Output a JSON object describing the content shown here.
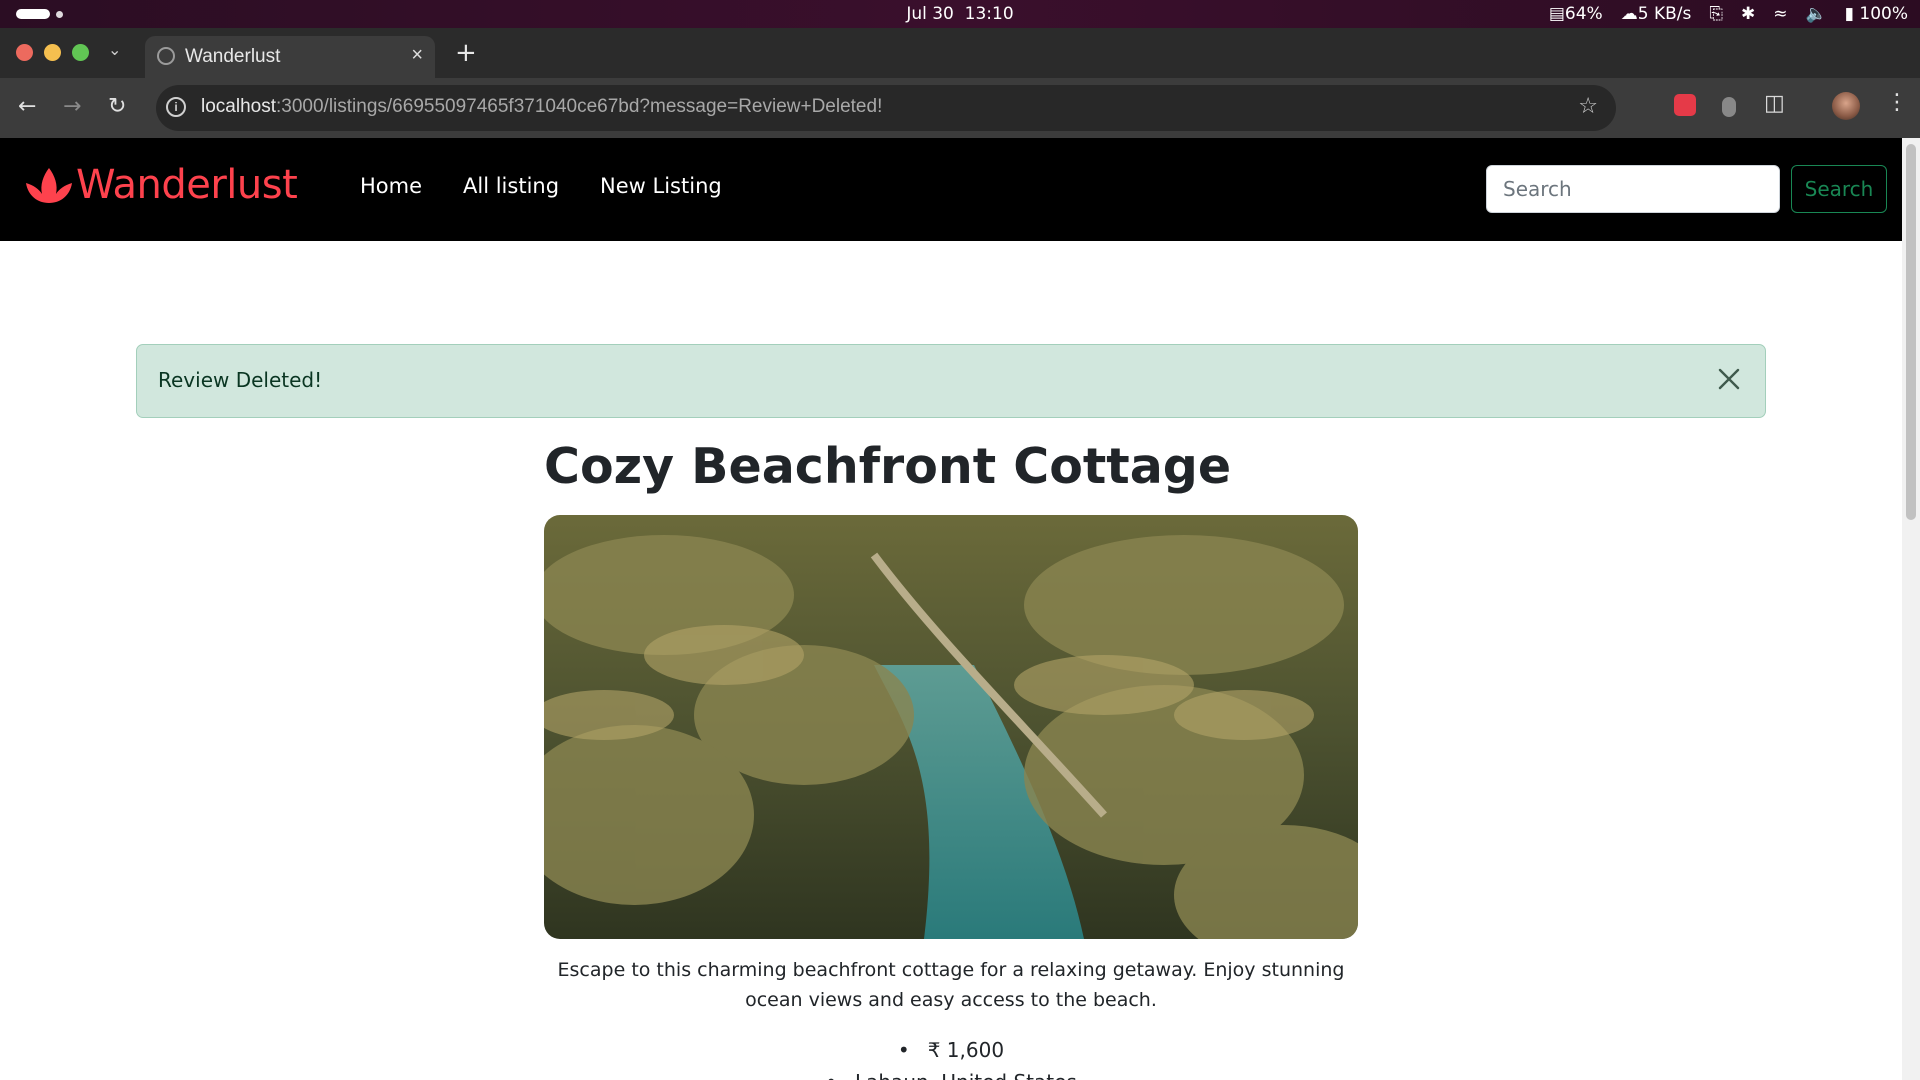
{
  "os": {
    "date": "Jul 30",
    "time": "13:10",
    "battery_saver": "64%",
    "network_speed": "5 KB/s",
    "battery": "100%"
  },
  "browser": {
    "tab_title": "Wanderlust",
    "url_host": "localhost",
    "url_rest": ":3000/listings/66955097465f371040ce67bd?message=Review+Deleted!"
  },
  "site": {
    "brand": "Wanderlust",
    "brand_color": "#fe424d",
    "nav_links": [
      "Home",
      "All listing",
      "New Listing"
    ],
    "search_placeholder": "Search",
    "search_button": "Search"
  },
  "alert": {
    "message": "Review Deleted!"
  },
  "listing": {
    "title": "Cozy Beachfront Cottage",
    "image_alt": "Tropical river lined with palm trees",
    "description": "Escape to this charming beachfront cottage for a relaxing getaway. Enjoy stunning ocean views and easy access to the beach.",
    "price": "₹ 1,600",
    "location": "Lahaun, United States"
  }
}
